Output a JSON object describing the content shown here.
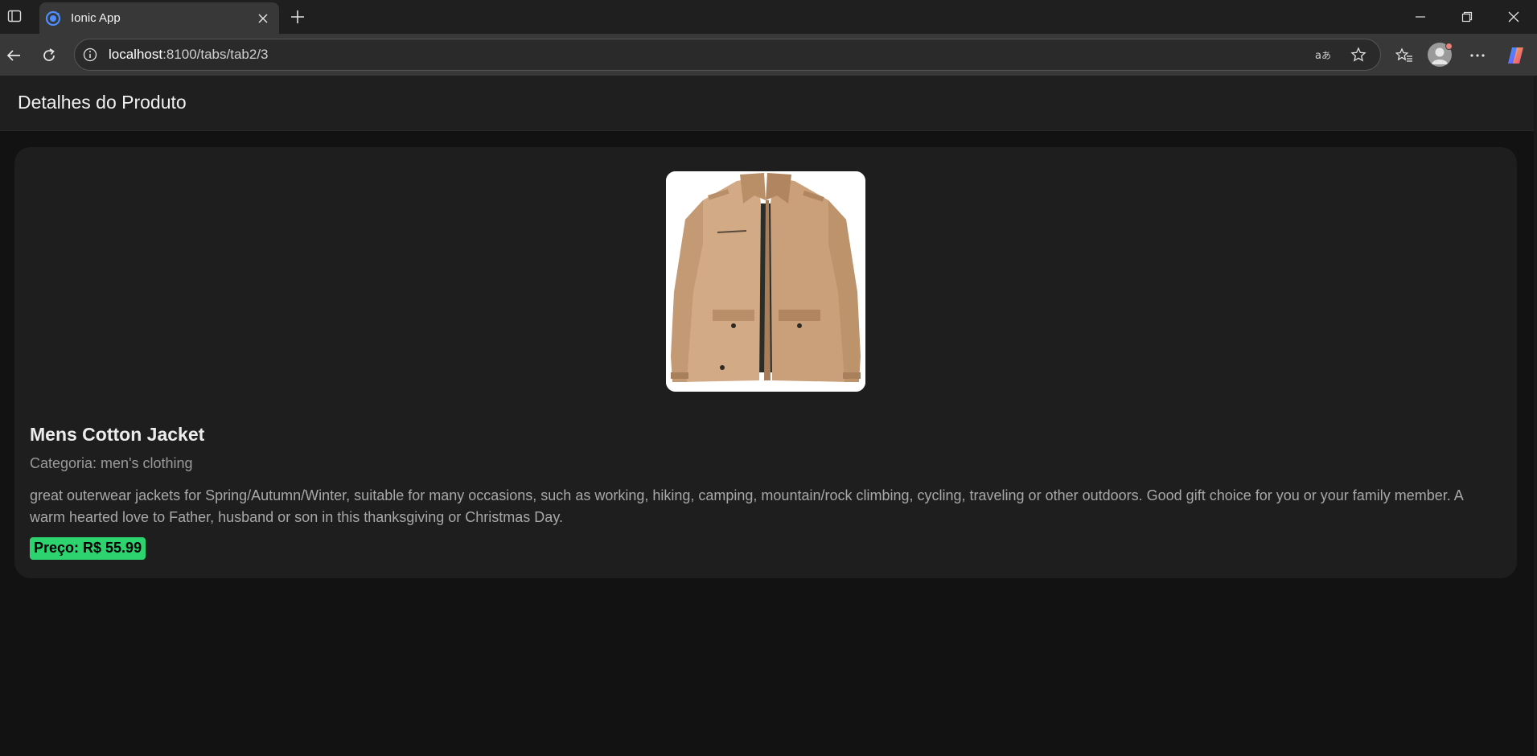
{
  "browser": {
    "tab_title": "Ionic App",
    "url_host": "localhost",
    "url_path": ":8100/tabs/tab2/3",
    "icons": {
      "sidebar": "tab-actions-icon",
      "favicon": "ionic-favicon-icon",
      "tab_close": "close-icon",
      "new_tab": "plus-icon",
      "back": "back-arrow-icon",
      "reload": "reload-icon",
      "site_info": "info-icon",
      "translate": "translate-icon",
      "favorite": "star-icon",
      "favorites": "favorites-icon",
      "profile": "profile-icon",
      "more": "more-icon",
      "copilot": "copilot-icon"
    }
  },
  "header": {
    "title": "Detalhes do Produto"
  },
  "product": {
    "name": "Mens Cotton Jacket",
    "category": "Categoria: men's clothing",
    "description": "great outerwear jackets for Spring/Autumn/Winter, suitable for many occasions, such as working, hiking, camping, mountain/rock climbing, cycling, traveling or other outdoors. Good gift choice for you or your family member. A warm hearted love to Father, husband or son in this thanksgiving or Christmas Day.",
    "price": "Preço: R$ 55.99",
    "price_color": "#2dd36f"
  }
}
